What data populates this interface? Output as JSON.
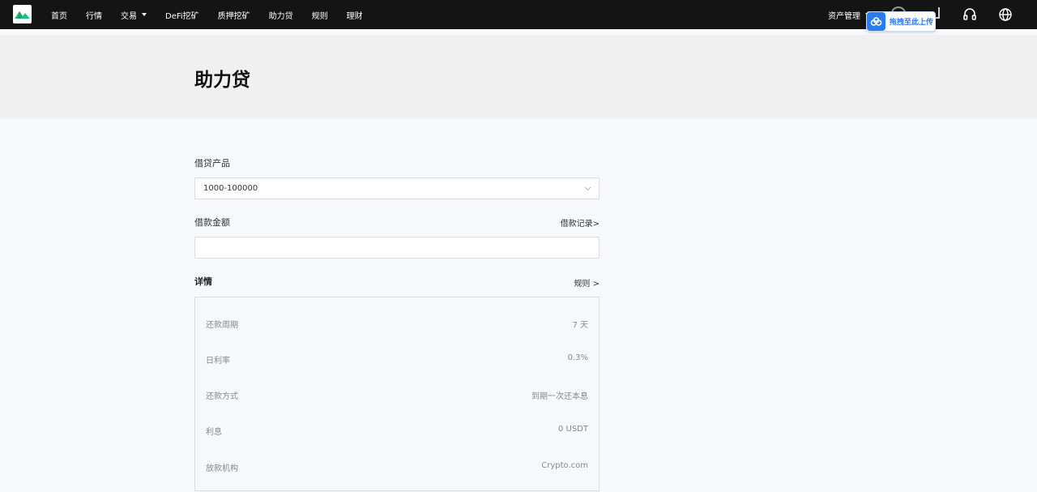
{
  "nav": {
    "items": [
      "首页",
      "行情",
      "交易",
      "DeFi挖矿",
      "质押挖矿",
      "助力贷",
      "规则",
      "理财"
    ],
    "asset_menu": "资产管理"
  },
  "upload_badge": {
    "label": "拖拽至此上传"
  },
  "icons": {
    "support": "headset-icon",
    "language": "globe-icon",
    "logo": "mountain-logo-icon"
  },
  "colors": {
    "topbar": "#141414",
    "brand_green": "#22c17a",
    "upload_blue": "#2b7cf0"
  },
  "page": {
    "title": "助力贷"
  },
  "form": {
    "product_label": "借贷产品",
    "product_value": "1000-100000",
    "amount_label": "借款金额",
    "amount_value": "",
    "borrow_records_link": "借款记录>",
    "details_title": "详情",
    "rules_link": "规则 >"
  },
  "details": [
    {
      "key": "还款周期",
      "value": "7 天"
    },
    {
      "key": "日利率",
      "value": "0.3%"
    },
    {
      "key": "还款方式",
      "value": "到期一次还本息"
    },
    {
      "key": "利息",
      "value": "0 USDT"
    },
    {
      "key": "放款机构",
      "value": "Crypto.com"
    }
  ]
}
